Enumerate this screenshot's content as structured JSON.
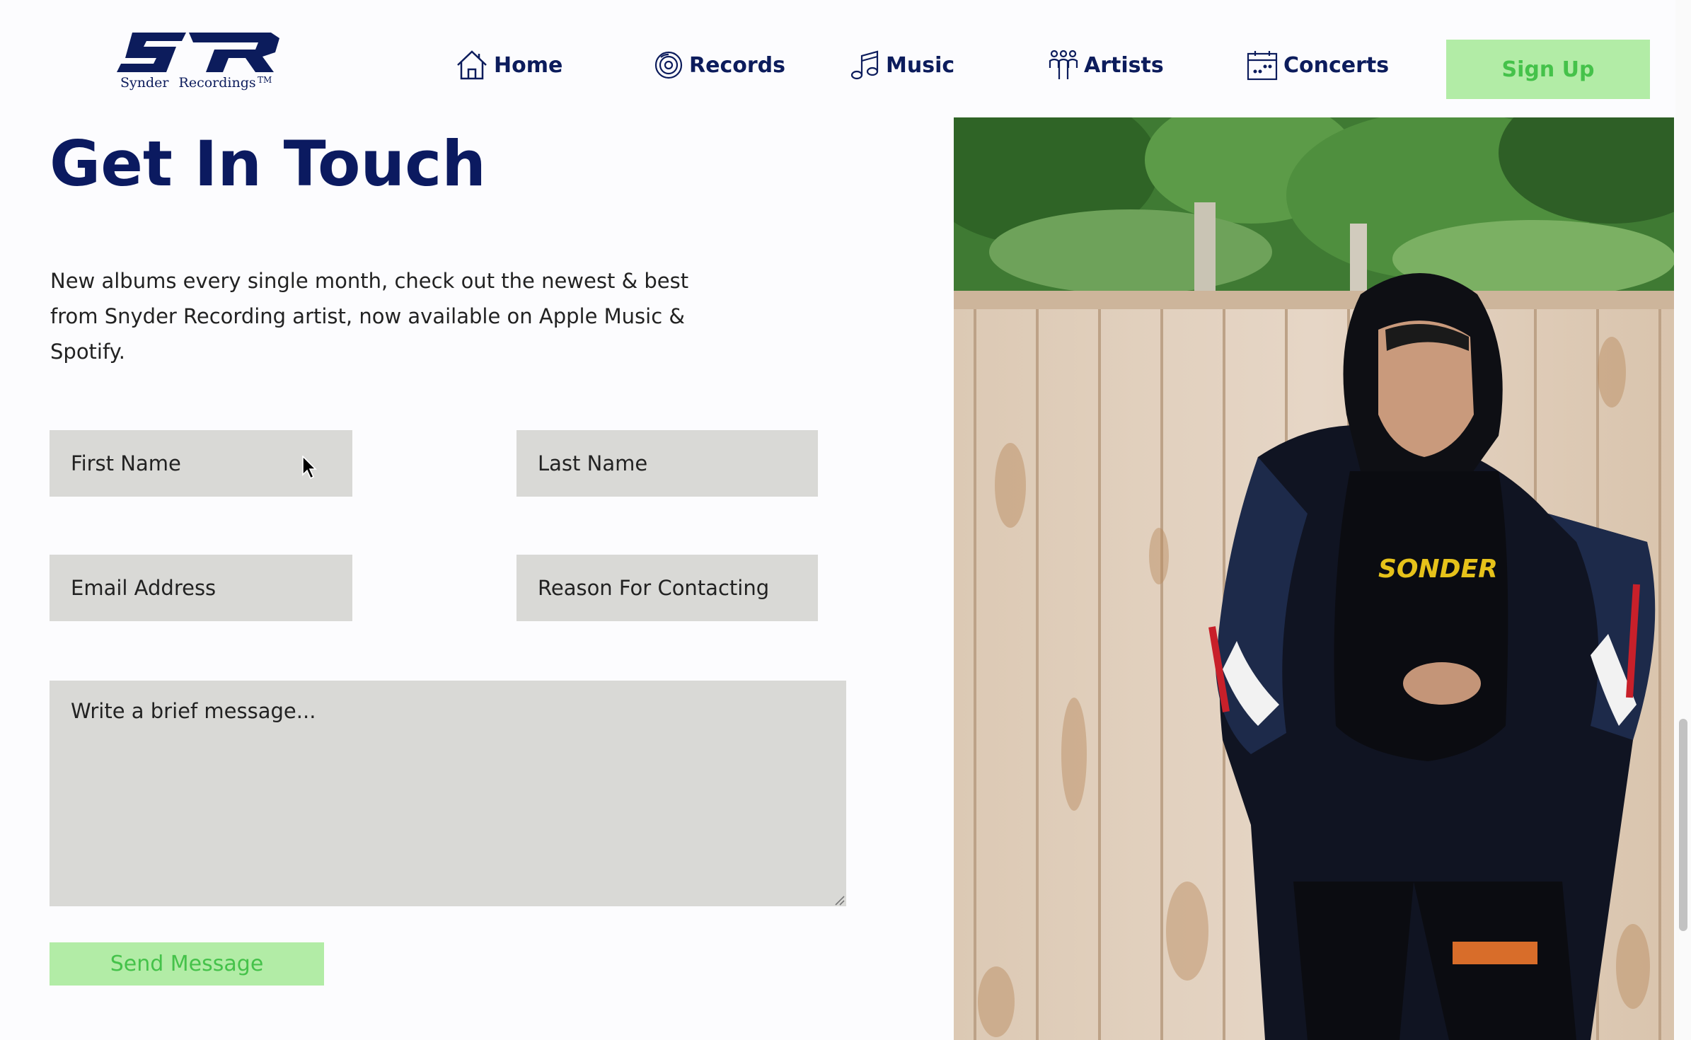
{
  "brand": {
    "logo_text": "Synder   Recordings",
    "trademark": "TM",
    "colors": {
      "navy": "#0c1c5c",
      "accent_bg": "#b2eca6",
      "accent_text": "#45c24a",
      "field_bg": "#d9d9d6"
    }
  },
  "nav": {
    "items": [
      {
        "label": "Home",
        "icon": "home-icon"
      },
      {
        "label": "Records",
        "icon": "vinyl-record-icon"
      },
      {
        "label": "Music",
        "icon": "music-note-icon"
      },
      {
        "label": "Artists",
        "icon": "people-icon"
      },
      {
        "label": "Concerts",
        "icon": "calendar-icon"
      }
    ],
    "signup_label": "Sign Up"
  },
  "main": {
    "title": "Get In Touch",
    "description": "New albums every single month, check out the newest & best from Snyder Recording artist, now available on Apple Music & Spotify."
  },
  "form": {
    "first_name_placeholder": "First Name",
    "last_name_placeholder": "Last Name",
    "email_placeholder": "Email Address",
    "reason_placeholder": "Reason For Contacting",
    "message_placeholder": "Write a brief message...",
    "send_label": "Send Message"
  },
  "photo": {
    "subject": "man in black hoodie and jacket in front of a rusty fence",
    "shirt_text": "SONDER"
  }
}
